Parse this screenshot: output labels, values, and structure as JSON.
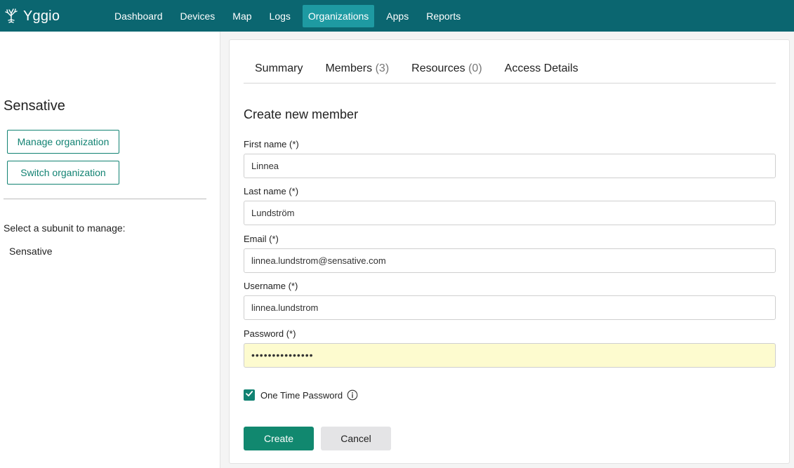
{
  "app": {
    "name": "Yggio",
    "logo_icon": "tree-icon"
  },
  "nav": [
    {
      "label": "Dashboard",
      "active": false
    },
    {
      "label": "Devices",
      "active": false
    },
    {
      "label": "Map",
      "active": false
    },
    {
      "label": "Logs",
      "active": false
    },
    {
      "label": "Organizations",
      "active": true
    },
    {
      "label": "Apps",
      "active": false
    },
    {
      "label": "Reports",
      "active": false
    }
  ],
  "sidebar": {
    "org_name": "Sensative",
    "manage_button": "Manage organization",
    "switch_button": "Switch organization",
    "subunit_label": "Select a subunit to manage:",
    "subunits": [
      "Sensative"
    ]
  },
  "tabs": [
    {
      "label": "Summary",
      "count": ""
    },
    {
      "label": "Members",
      "count": "(3)"
    },
    {
      "label": "Resources",
      "count": "(0)"
    },
    {
      "label": "Access Details",
      "count": ""
    }
  ],
  "form": {
    "title": "Create new member",
    "first_name": {
      "label": "First name (*)",
      "value": "Linnea"
    },
    "last_name": {
      "label": "Last name (*)",
      "value": "Lundström"
    },
    "email": {
      "label": "Email (*)",
      "value": "linnea.lundstrom@sensative.com"
    },
    "username": {
      "label": "Username (*)",
      "value": "linnea.lundstrom"
    },
    "password": {
      "label": "Password (*)",
      "value": "•••••••••••••••"
    },
    "one_time_password": {
      "label": "One Time Password",
      "checked": true
    },
    "create_label": "Create",
    "cancel_label": "Cancel"
  },
  "colors": {
    "topbar": "#0b6670",
    "nav_active": "#1e9aa2",
    "accent": "#118272",
    "create_button": "#11886f",
    "autofill": "#fdfbcf"
  }
}
